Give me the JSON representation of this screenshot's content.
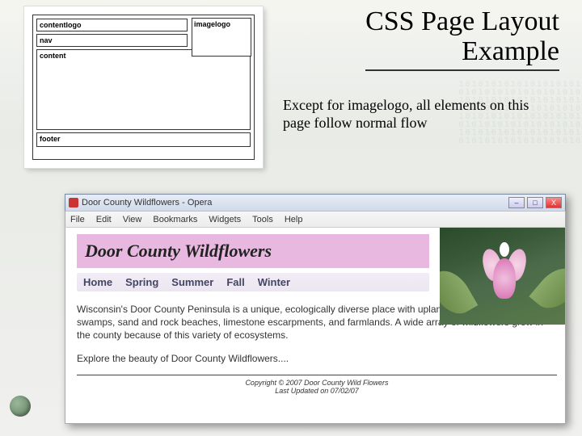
{
  "slide": {
    "title_line1": "CSS Page Layout",
    "title_line2": "Example",
    "subtext": "Except for imagelogo, all elements on this page follow normal flow"
  },
  "wireframe": {
    "contentlogo": "contentlogo",
    "imagelogo": "imagelogo",
    "nav": "nav",
    "content": "content",
    "footer": "footer"
  },
  "browser": {
    "window_title": "Door County Wildflowers - Opera",
    "menu": [
      "File",
      "Edit",
      "View",
      "Bookmarks",
      "Widgets",
      "Tools",
      "Help"
    ],
    "win_buttons": {
      "min": "–",
      "max": "□",
      "close": "X"
    }
  },
  "page": {
    "heading": "Door County Wildflowers",
    "nav": [
      "Home",
      "Spring",
      "Summer",
      "Fall",
      "Winter"
    ],
    "para1": "Wisconsin's Door County Peninsula is a unique, ecologically diverse place with upland and boreal forest, bogs, swamps, sand and rock beaches, limestone escarpments, and farmlands. A wide array of wildflowers grow in the county because of this variety of ecosystems.",
    "para2": "Explore the beauty of Door County Wildflowers....",
    "footer_line1": "Copyright © 2007 Door County Wild Flowers",
    "footer_line2": "Last Updated on 07/02/07"
  }
}
